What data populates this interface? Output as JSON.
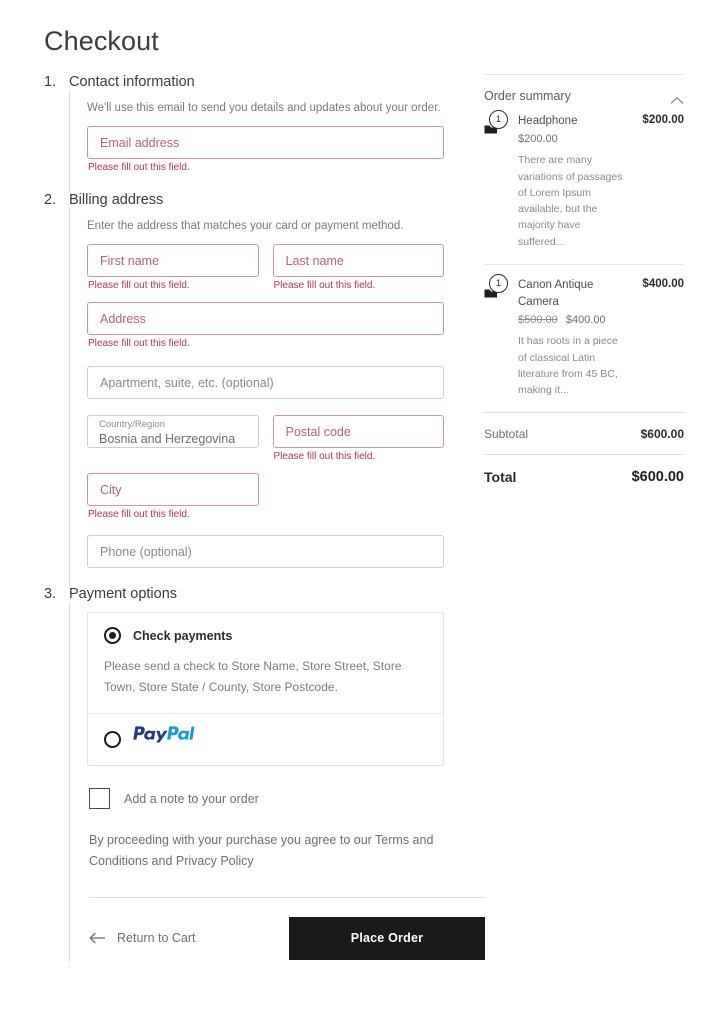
{
  "page": {
    "title": "Checkout"
  },
  "steps": [
    {
      "number": "1.",
      "title": "Contact information",
      "help": "We'll use this email to send you details and updates about your order."
    },
    {
      "number": "2.",
      "title": "Billing address",
      "help": "Enter the address that matches your card or payment method."
    },
    {
      "number": "3.",
      "title": "Payment options"
    }
  ],
  "fields": {
    "email": {
      "placeholder": "Email address",
      "error": "Please fill out this field."
    },
    "first_name": {
      "placeholder": "First name",
      "error": "Please fill out this field."
    },
    "last_name": {
      "placeholder": "Last name",
      "error": "Please fill out this field."
    },
    "address": {
      "placeholder": "Address",
      "error": "Please fill out this field."
    },
    "apartment": {
      "placeholder": "Apartment, suite, etc. (optional)"
    },
    "country": {
      "label": "Country/Region",
      "value": "Bosnia and Herzegovina"
    },
    "postal_code": {
      "placeholder": "Postal code",
      "error": "Please fill out this field."
    },
    "city": {
      "placeholder": "City",
      "error": "Please fill out this field."
    },
    "phone": {
      "placeholder": "Phone (optional)"
    }
  },
  "payment": {
    "options": [
      {
        "id": "check-payments",
        "label": "Check payments",
        "selected": true,
        "description": "Please send a check to Store Name, Store Street, Store Town, Store State / County, Store Postcode."
      },
      {
        "id": "paypal",
        "label": "PayPal",
        "selected": false,
        "logo_text_dark": "Pay",
        "logo_text_light": "Pal"
      }
    ]
  },
  "footer": {
    "note_checkbox_label": "Add a note to your order",
    "note_checked": false,
    "terms_text": "By proceeding with your purchase you agree to our Terms and Conditions and Privacy Policy",
    "return_label": "Return to Cart",
    "place_order_label": "Place Order"
  },
  "summary": {
    "title": "Order summary",
    "collapse_state": "expanded",
    "items": [
      {
        "name": "Headphone",
        "quantity": "1",
        "line_total": "$200.00",
        "price": "$200.00",
        "regular_price": null,
        "sale_price": null,
        "description": "There are many variations of passages of Lorem Ipsum available, but the majority have suffered..."
      },
      {
        "name": "Canon Antique Camera",
        "quantity": "1",
        "line_total": "$400.00",
        "price": null,
        "regular_price": "$500.00",
        "sale_price": "$400.00",
        "description": "It has roots in a piece of classical Latin literature from 45 BC, making it..."
      }
    ],
    "totals": [
      {
        "label": "Subtotal",
        "value": "$600.00"
      },
      {
        "label": "Total",
        "value": "$600.00"
      }
    ]
  },
  "colors": {
    "error_red": "#b0394a",
    "field_error_border": "#cc9999",
    "placeholder_error": "#b5636e",
    "button_dark": "#1a1a1a",
    "paypal_dark": "#253b80",
    "paypal_light": "#179bd7",
    "text_muted": "#7a7a7a"
  }
}
